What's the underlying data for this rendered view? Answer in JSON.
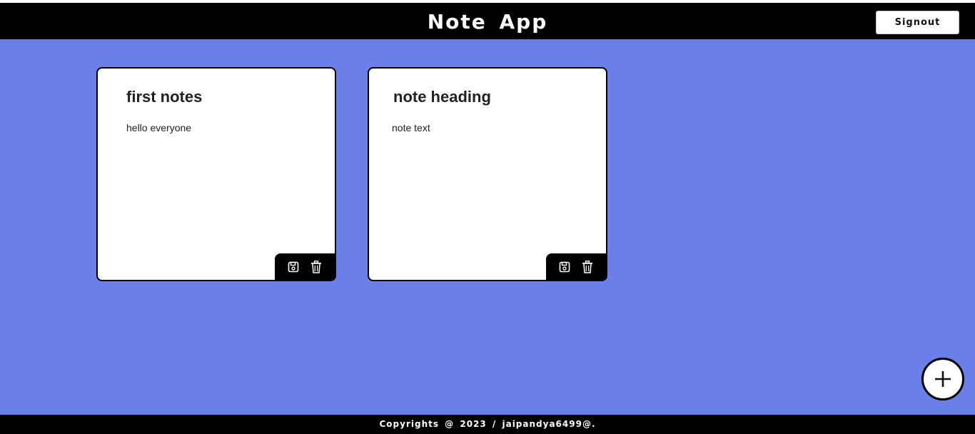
{
  "header": {
    "title": "Note  App",
    "signout_label": "Signout"
  },
  "notes": [
    {
      "title": "first notes",
      "text": "hello everyone",
      "save_icon": "save-icon",
      "delete_icon": "trash-icon"
    },
    {
      "title": "note heading",
      "text": "note text",
      "save_icon": "save-icon",
      "delete_icon": "trash-icon"
    }
  ],
  "fab": {
    "icon": "plus-icon"
  },
  "footer": {
    "text": "Copyrights  @  2023  /  jaipandya6499@."
  },
  "colors": {
    "background": "#6a7fe8",
    "header": "#000000",
    "card": "#ffffff"
  }
}
